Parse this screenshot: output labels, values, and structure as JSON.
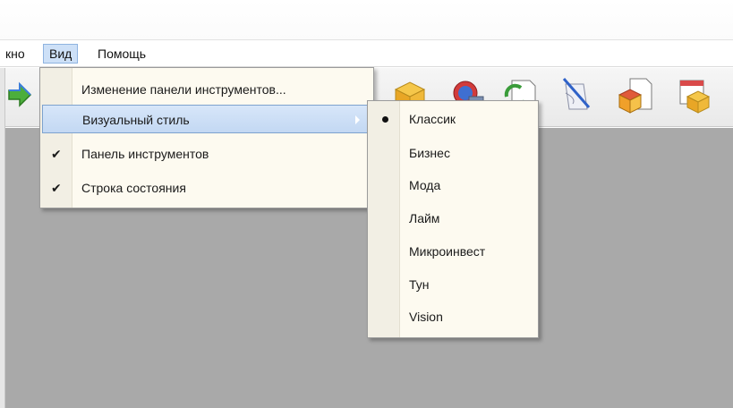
{
  "menubar": {
    "items": [
      {
        "label": "кно"
      },
      {
        "label": "Вид"
      },
      {
        "label": "Помощь"
      }
    ]
  },
  "view_menu": {
    "items": [
      {
        "label": "Изменение панели инструментов...",
        "checked": false
      },
      {
        "label": "Визуальный стиль",
        "checked": false,
        "submenu": true,
        "highlighted": true
      },
      {
        "label": "Панель инструментов",
        "checked": true
      },
      {
        "label": "Строка состояния",
        "checked": true
      }
    ],
    "check_glyph": "✔"
  },
  "style_submenu": {
    "items": [
      {
        "label": "Классик",
        "selected": true
      },
      {
        "label": "Бизнес"
      },
      {
        "label": "Мода"
      },
      {
        "label": "Лайм"
      },
      {
        "label": "Микроинвест"
      },
      {
        "label": "Тун"
      },
      {
        "label": "Vision"
      }
    ]
  },
  "toolbar": {
    "icons": [
      "arrow-icon",
      "box-icon",
      "globe-shield-icon",
      "refresh-document-icon",
      "quill-scroll-icon",
      "document-box-icon",
      "calendar-box-icon"
    ]
  },
  "colors": {
    "menu_bg": "#fdfaf0",
    "highlight": "#c3d8f3",
    "workspace": "#a9a9a9"
  }
}
